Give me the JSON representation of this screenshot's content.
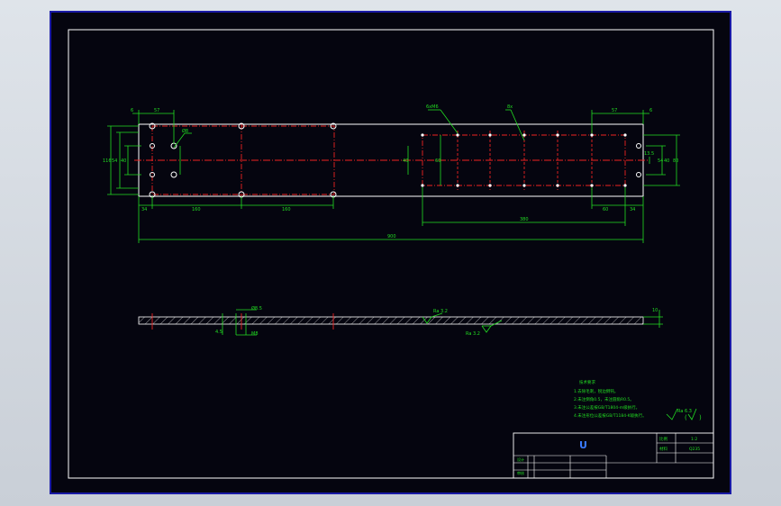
{
  "colors": {
    "background": "#000000",
    "viewport_border": "#1a1aa6",
    "outline": "#ffffff",
    "dimension": "#22dd22",
    "centerline": "#ee2222",
    "hatch": "#ffffff",
    "frame": "#ffffff",
    "title_text": "#3a7bff"
  },
  "top_view": {
    "dims": {
      "left_tab": "6",
      "left_top": "57",
      "left_height": "116",
      "left_inner": "54",
      "left_inner2": "40",
      "hole_dia": "Ø8",
      "thread_callout": "6xM6",
      "holes_label": "8x",
      "right_tab": "6",
      "right_top": "57",
      "right_inner": "13.5",
      "right_width": "54",
      "right_height": "80",
      "right_inner2": "40",
      "mid_v1": "40",
      "mid_v2": "60",
      "bottom_left": "34",
      "bottom_span1": "160",
      "bottom_span2": "160",
      "bottom_right_span": "380",
      "bottom_right_a": "60",
      "bottom_right_b": "34",
      "overall_length": "900"
    }
  },
  "side_view": {
    "dims": {
      "hole_dia": "Ø8.5",
      "counterbore": "M8",
      "thickness": "4.5",
      "right_thk": "10",
      "roughness_top": "Ra 3.2",
      "roughness_bottom": "Ra 3.2"
    }
  },
  "notes": {
    "title": "技术要求",
    "items": [
      "1.去除毛刺，锐边倒钝。",
      "2.未注倒角0.5，未注圆角R0.5。",
      "3.未注公差按GB/T1804-m级执行。",
      "4.未注形位公差按GB/T1184-K级执行。"
    ]
  },
  "roughness_symbol": {
    "label": "Ra 6.3"
  },
  "title_block": {
    "part_name": "U",
    "scale_label": "比例",
    "scale_value": "1:2",
    "material_label": "材料",
    "material_value": "Q235",
    "row_a": "设计",
    "row_b": "审核"
  }
}
